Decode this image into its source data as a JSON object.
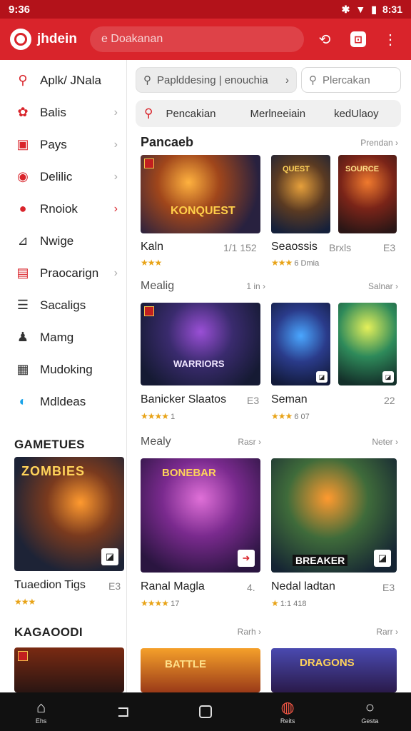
{
  "status": {
    "time": "9:36",
    "clock_right": "8:31"
  },
  "appbar": {
    "title": "jhdein",
    "search_text": "e Doakanan"
  },
  "sidebar": {
    "items": [
      {
        "label": "Aplk/ JNala",
        "icon": "search-icon",
        "chev": false
      },
      {
        "label": "Balis",
        "icon": "brain-icon",
        "chev": true
      },
      {
        "label": "Pays",
        "icon": "card-icon",
        "chev": true
      },
      {
        "label": "Delilic",
        "icon": "target-icon",
        "chev": true
      },
      {
        "label": "Rnoiok",
        "icon": "runner-icon",
        "chev": true
      },
      {
        "label": "Nwige",
        "icon": "chart-icon",
        "chev": false
      },
      {
        "label": "Praocarign",
        "icon": "report-icon",
        "chev": true
      },
      {
        "label": "Sacaligs",
        "icon": "tray-icon",
        "chev": false
      },
      {
        "label": "Mamg",
        "icon": "user-icon",
        "chev": false
      },
      {
        "label": "Mudoking",
        "icon": "document-icon",
        "chev": false
      },
      {
        "label": "Mdldeas",
        "icon": "bubble-icon",
        "chev": false
      }
    ],
    "section1": "GAMETUES",
    "section1_card": {
      "name": "Tuaedion Tigs",
      "meta": "E3",
      "stars": "★★★",
      "rating": ""
    },
    "section2": "KAGAOODI"
  },
  "main": {
    "search_field": "Paplddesing | enouchia",
    "search_field2": "Plercakan",
    "tabs": [
      "Pencakian",
      "Merlneeiain",
      "kedUlaoy"
    ],
    "sections": [
      {
        "title": "Pancaeb",
        "more": "Prendan ›"
      },
      {
        "title": "Mealig",
        "more": "1 in ›"
      },
      {
        "title": "Mealy",
        "more": "Rasr ›"
      },
      {
        "title": "",
        "more": "Rarh ›"
      }
    ],
    "extra_more": [
      "Salnar ›",
      "Neter ›",
      "Rarr ›"
    ],
    "games_row1": [
      {
        "name": "Kaln",
        "meta": "1/1 152",
        "stars": "★★★",
        "rating": ""
      },
      {
        "name": "Seaossis",
        "meta": "Brxls",
        "meta2": "E3",
        "stars": "★★★",
        "rating": "6 Dmia"
      }
    ],
    "games_row2": [
      {
        "name": "Banicker Slaatos",
        "meta": "E3",
        "stars": "★★★★",
        "rating": "1"
      },
      {
        "name": "Seman",
        "meta": "22",
        "stars": "★★★",
        "rating": "6 07"
      }
    ],
    "games_row3": [
      {
        "name": "Ranal Magla",
        "meta": "4.",
        "stars": "★★★★",
        "rating": "17"
      },
      {
        "name": "Nedal ladtan",
        "meta": "E3",
        "stars": "★",
        "rating": "1:1 418"
      }
    ]
  },
  "nav": [
    "Ehs",
    "",
    "",
    "Reits",
    "Gesta"
  ],
  "colors": {
    "brand": "#d9242b",
    "status": "#b3121a"
  }
}
